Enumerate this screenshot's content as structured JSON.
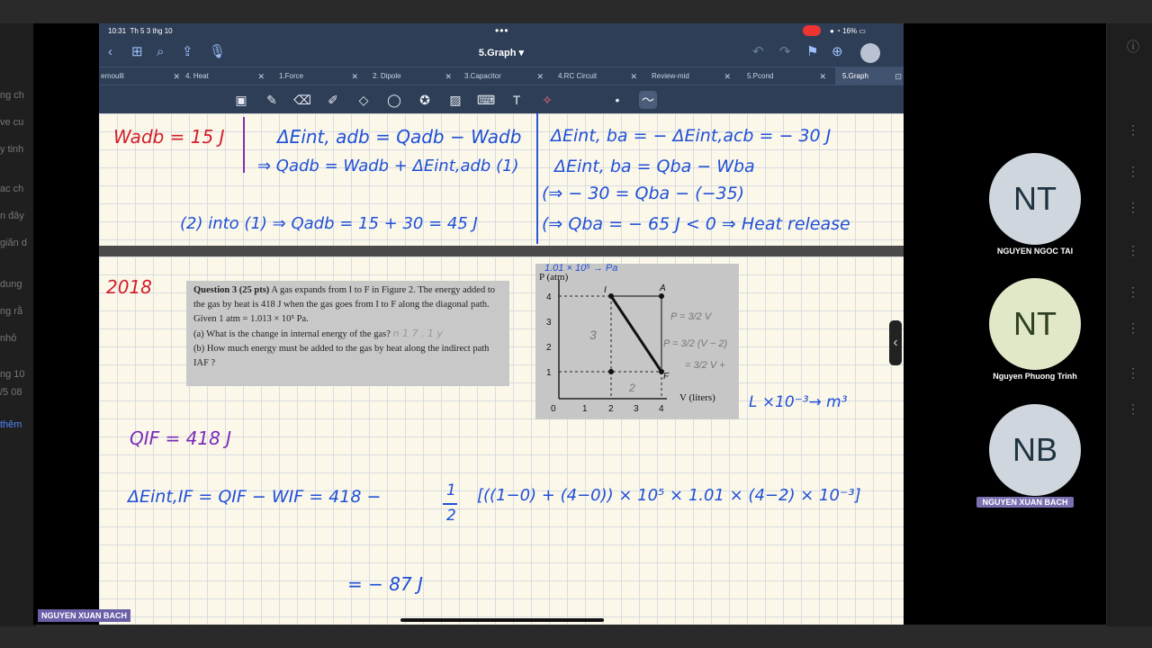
{
  "status": {
    "time": "10:31",
    "date": "Th 5 3 thg 10",
    "battery": "16%"
  },
  "document": {
    "title": "5.Graph"
  },
  "tabs": [
    {
      "label": "ernoulli"
    },
    {
      "label": "4. Heat"
    },
    {
      "label": "1.Force"
    },
    {
      "label": "2. Dipole"
    },
    {
      "label": "3.Capacitor"
    },
    {
      "label": "4.RC Circuit"
    },
    {
      "label": "Review-mid"
    },
    {
      "label": "5.Pcond"
    },
    {
      "label": "5.Graph"
    }
  ],
  "top_page": {
    "left_col": {
      "wadb": "Wadb = 15 J"
    },
    "mid_col": {
      "line1": "ΔEint, adb = Qadb − Wadb",
      "line2": "⇒  Qadb = Wadb + ΔEint,adb (1)",
      "line3": "(2) into (1) ⇒  Qadb = 15 + 30 = 45 J"
    },
    "right_col": {
      "line1": "ΔEint, ba = − ΔEint,acb = − 30 J",
      "line2": "ΔEint, ba = Qba − Wba",
      "line3": "(⇒  − 30 = Qba − (−35)",
      "line4": "(⇒  Qba = − 65 J < 0 ⇒ Heat release"
    }
  },
  "bottom_page": {
    "year": "2018",
    "question": {
      "heading": "Question 3 (25 pts)",
      "body": "A gas expands from I to F in Figure 2. The energy added to the gas by heat is 418 J when the gas goes from I to F along the diagonal path. Given 1 atm = 1.013 × 10⁵ Pa.",
      "a": "(a) What is the change in internal energy of the gas?",
      "b": "(b) How much energy must be added to the gas by heat along the indirect path IAF ?",
      "scribble": "n 1 7 . 1 y"
    },
    "graph": {
      "ylabel": "P (atm)",
      "xlabel": "V (liters)",
      "yticks": [
        "1",
        "2",
        "3",
        "4"
      ],
      "xticks": [
        "0",
        "1",
        "2",
        "3",
        "4"
      ],
      "pt_I": "I",
      "pt_A": "A",
      "pt_F": "F",
      "note_top": "1.01 × 10⁵ → Pa",
      "note_3": "3",
      "note_2": "2",
      "note_eq1": "P = 3/2 V",
      "note_eq2": "P = 3/2 (V − 2)",
      "note_eq3": "= 3/2 V +"
    },
    "unit_note": "L ×10⁻³→ m³",
    "qif": "QIF = 418 J",
    "eq_lhs": "ΔEint,IF = QIF − WIF  =  418 − ",
    "eq_frac_num": "1",
    "eq_frac_den": "2",
    "eq_rhs": "[((1−0) + (4−0)) × 10⁵ × 1.01 × (4−2) × 10⁻³]",
    "result": "=  − 87  J"
  },
  "participants": [
    {
      "initials": "NT",
      "name": "NGUYEN NGOC TAI"
    },
    {
      "initials": "NT",
      "name": "Nguyen Phuong Trinh"
    },
    {
      "initials": "NB",
      "name": "NGUYEN XUAN BACH"
    }
  ],
  "presenter": "NGUYEN XUAN BACH",
  "bg_left": [
    "ng ch",
    "ve cu",
    "y tinh",
    "ac ch",
    "n đây",
    "giãn d",
    "dung",
    "ng rằ",
    "nhỏ",
    "ng 10",
    "/5 08",
    "thêm"
  ]
}
